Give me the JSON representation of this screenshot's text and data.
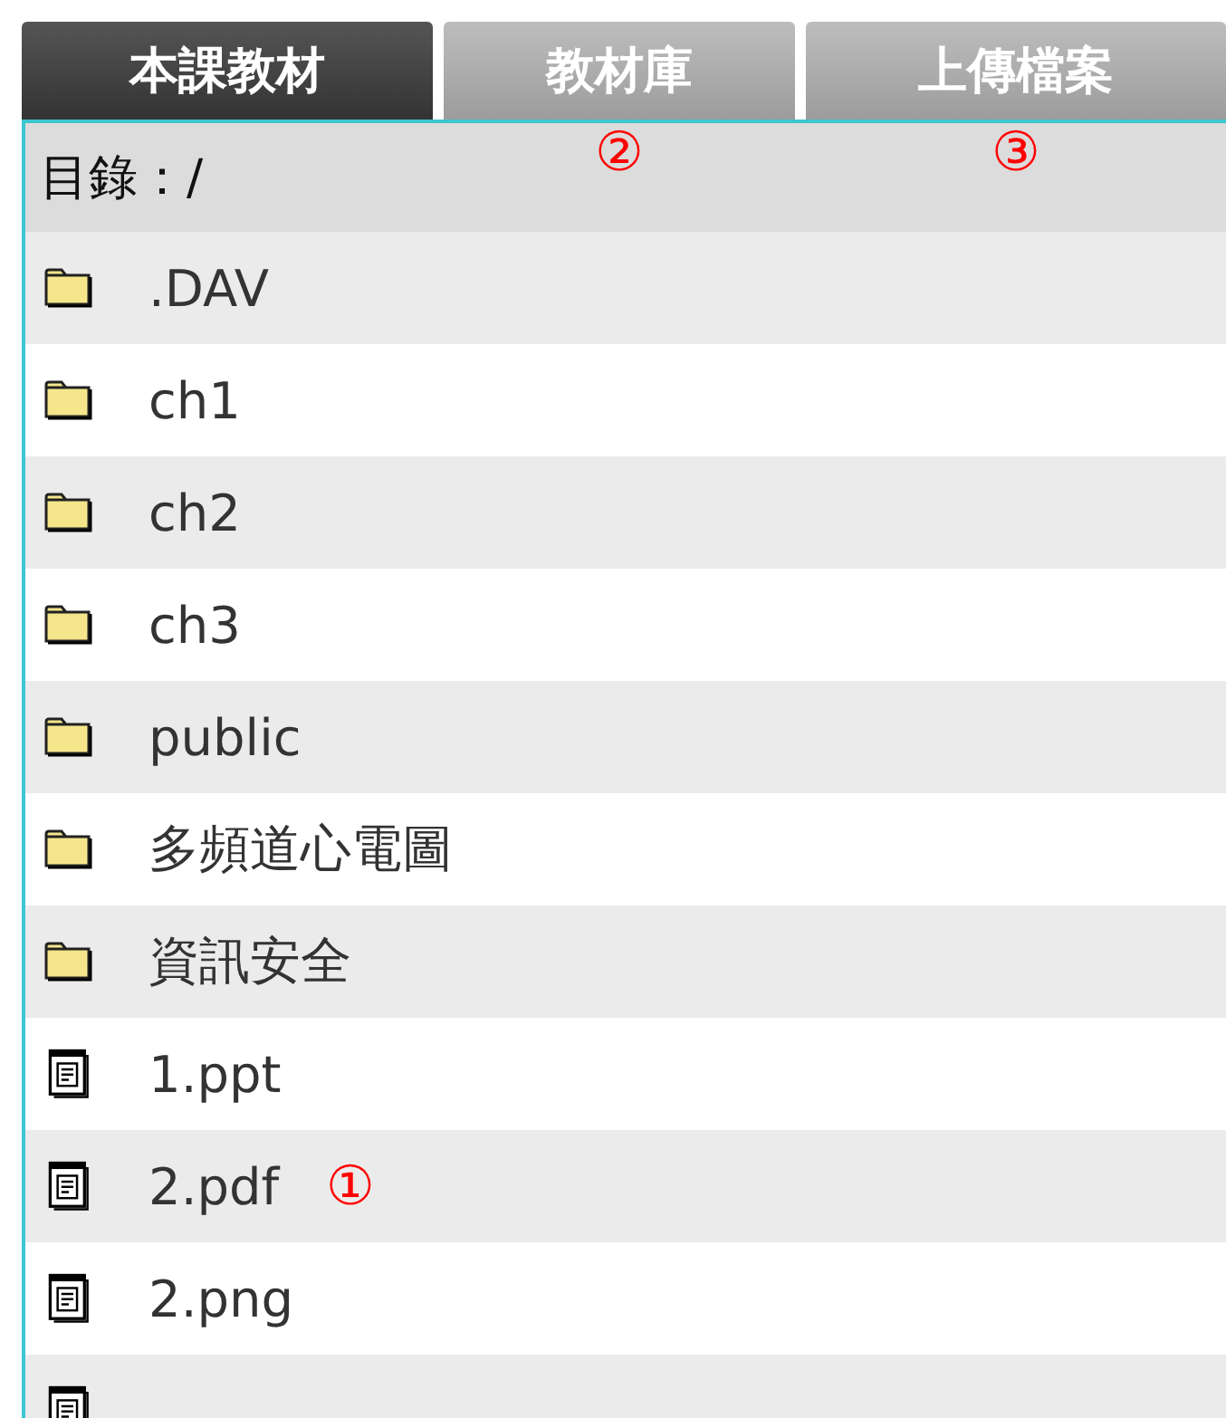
{
  "tabs": [
    {
      "label": "本課教材",
      "selected": true
    },
    {
      "label": "教材庫",
      "selected": false,
      "note": "②"
    },
    {
      "label": "上傳檔案",
      "selected": false,
      "note": "③"
    }
  ],
  "path_label": "目錄：/",
  "items": [
    {
      "kind": "folder",
      "name": ".DAV"
    },
    {
      "kind": "folder",
      "name": "ch1"
    },
    {
      "kind": "folder",
      "name": "ch2"
    },
    {
      "kind": "folder",
      "name": "ch3"
    },
    {
      "kind": "folder",
      "name": "public"
    },
    {
      "kind": "folder",
      "name": "多頻道心電圖"
    },
    {
      "kind": "folder",
      "name": "資訊安全"
    },
    {
      "kind": "file",
      "name": "1.ppt"
    },
    {
      "kind": "file",
      "name": "2.pdf",
      "note": "①"
    },
    {
      "kind": "file",
      "name": "2.png"
    },
    {
      "kind": "file"
    }
  ]
}
